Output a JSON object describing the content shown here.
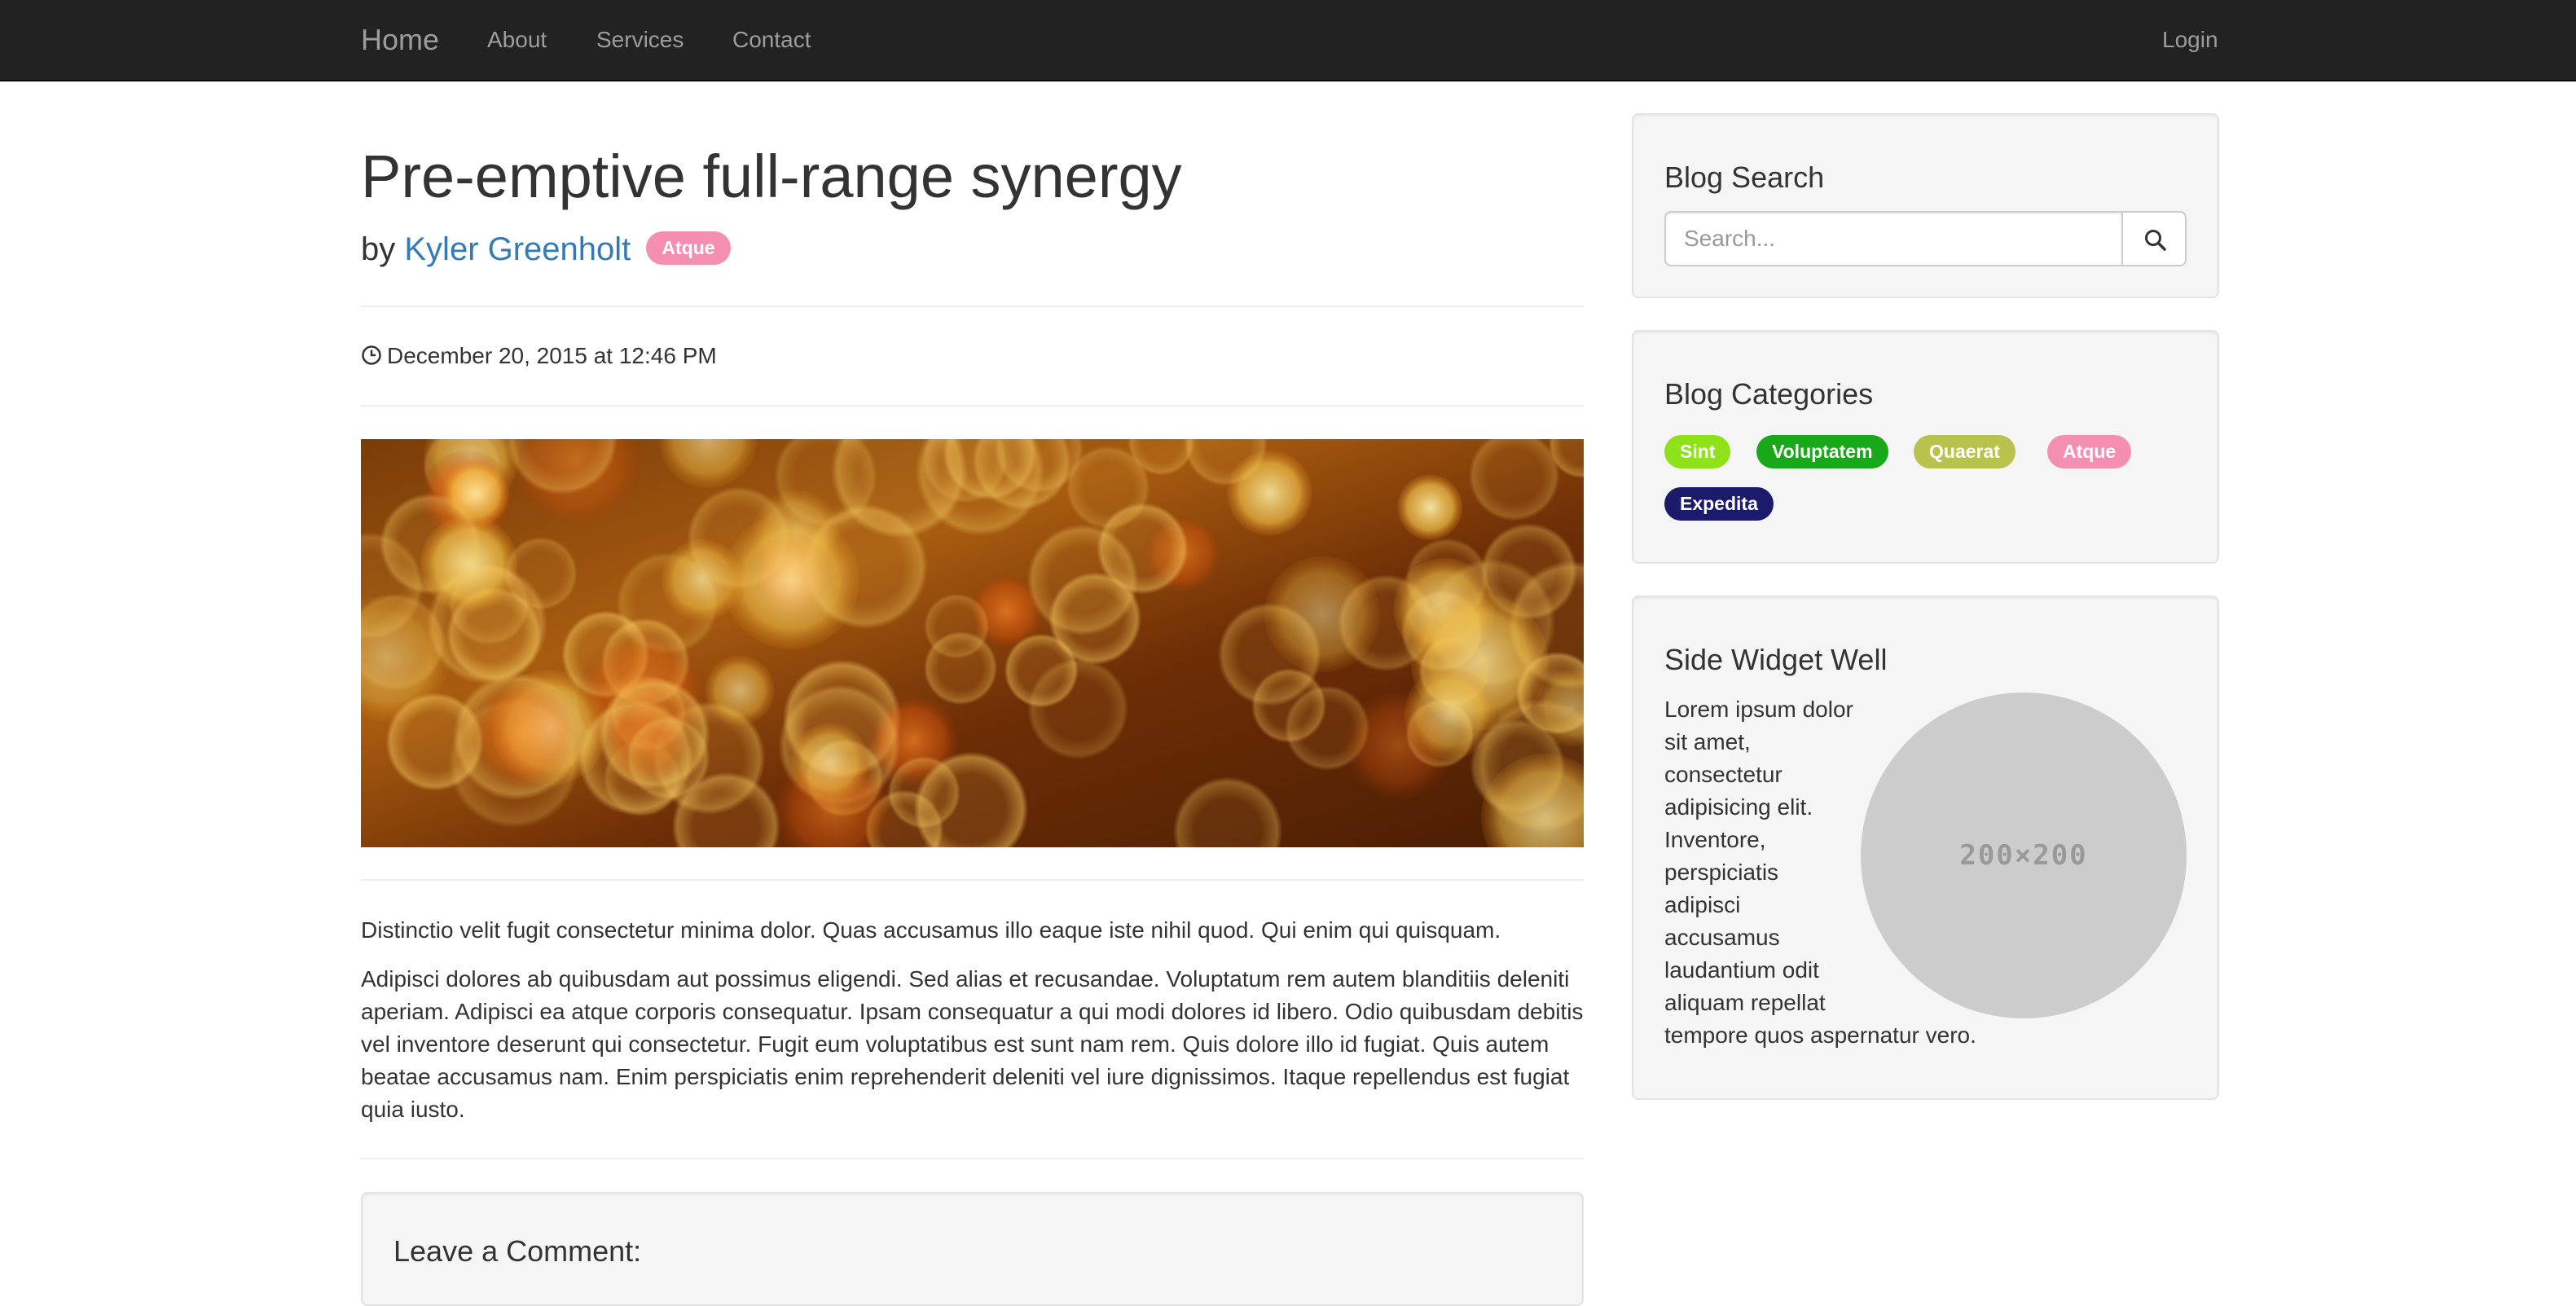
{
  "navbar": {
    "brand": "Home",
    "links": [
      "About",
      "Services",
      "Contact"
    ],
    "login": "Login"
  },
  "post": {
    "title": "Pre-emptive full-range synergy",
    "by_prefix": "by",
    "author": "Kyler Greenholt",
    "category_badge": {
      "label": "Atque",
      "color": "#f48fb1"
    },
    "date": "December 20, 2015 at 12:46 PM",
    "paragraphs": [
      "Distinctio velit fugit consectetur minima dolor. Quas accusamus illo eaque iste nihil quod. Qui enim qui quisquam.",
      "Adipisci dolores ab quibusdam aut possimus eligendi. Sed alias et recusandae. Voluptatum rem autem blanditiis deleniti aperiam. Adipisci ea atque corporis consequatur. Ipsam consequatur a qui modi dolores id libero. Odio quibusdam debitis vel inventore deserunt qui consectetur. Fugit eum voluptatibus est sunt nam rem. Quis dolore illo id fugiat. Quis autem beatae accusamus nam. Enim perspiciatis enim reprehenderit deleniti vel iure dignissimos. Itaque repellendus est fugiat quia iusto."
    ]
  },
  "comment": {
    "heading": "Leave a Comment:"
  },
  "sidebar": {
    "search": {
      "heading": "Blog Search",
      "placeholder": "Search...",
      "value": ""
    },
    "categories": {
      "heading": "Blog Categories",
      "items": [
        {
          "label": "Sint",
          "color": "#8fe21a"
        },
        {
          "label": "Voluptatem",
          "color": "#18a81a"
        },
        {
          "label": "Quaerat",
          "color": "#b9c24c"
        },
        {
          "label": "Atque",
          "color": "#f48fb1"
        },
        {
          "label": "Expedita",
          "color": "#1c1a6b"
        }
      ]
    },
    "side_widget": {
      "heading": "Side Widget Well",
      "text_lines": [
        "Lorem ipsum dolor",
        "sit amet,",
        "consectetur",
        "adipisicing elit.",
        "Inventore,",
        "perspiciatis",
        "adipisci",
        "accusamus",
        "laudantium odit",
        "aliquam repellat",
        "tempore quos aspernatur vero."
      ],
      "placeholder_image_label": "200×200"
    }
  },
  "colors": {
    "navbar_bg": "#222222",
    "nav_text": "#9d9d9d",
    "link": "#337ab7",
    "well_bg": "#f5f5f5"
  }
}
